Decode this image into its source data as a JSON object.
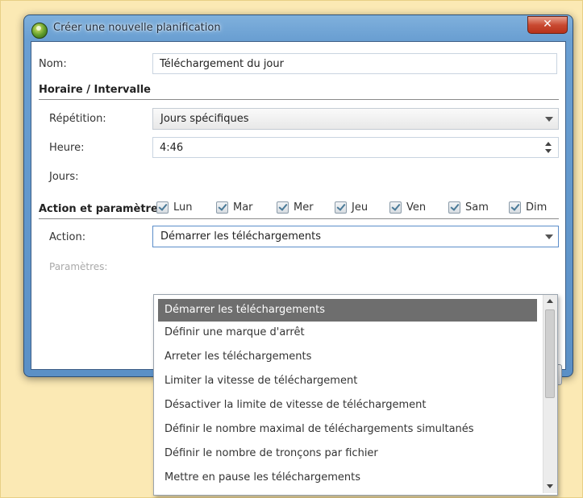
{
  "window": {
    "title": "Créer une nouvelle planification",
    "close_label": "✕"
  },
  "name_field": {
    "label": "Nom:",
    "value": "Téléchargement du jour"
  },
  "schedule_section": {
    "title": "Horaire / Intervalle",
    "repeat": {
      "label": "Répétition:",
      "value": "Jours spécifiques"
    },
    "time": {
      "label": "Heure:",
      "value": "4:46"
    },
    "days": {
      "label": "Jours:",
      "items": [
        {
          "label": "Lun",
          "checked": true
        },
        {
          "label": "Mar",
          "checked": true
        },
        {
          "label": "Mer",
          "checked": true
        },
        {
          "label": "Jeu",
          "checked": true
        },
        {
          "label": "Ven",
          "checked": true
        },
        {
          "label": "Sam",
          "checked": true
        },
        {
          "label": "Dim",
          "checked": true
        }
      ]
    }
  },
  "action_section": {
    "title": "Action et paramètres",
    "action": {
      "label": "Action:",
      "value": "Démarrer les téléchargements"
    },
    "params": {
      "label": "Paramètres:"
    }
  },
  "action_dropdown": {
    "selected_index": 0,
    "options": [
      "Démarrer les téléchargements",
      "Définir une marque d'arrêt",
      "Arreter les téléchargements",
      "Limiter la vitesse de téléchargement",
      "Désactiver la limite de vitesse de téléchargement",
      "Définir le nombre maximal de téléchargements simultanés",
      "Définir le nombre de tronçons par fichier",
      "Mettre en pause les téléchargements"
    ]
  }
}
